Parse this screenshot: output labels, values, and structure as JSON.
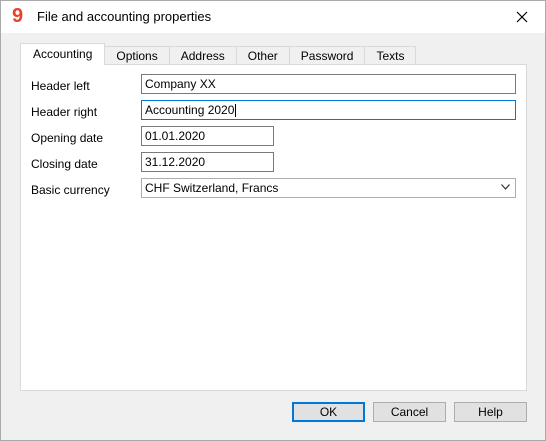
{
  "window": {
    "title": "File and accounting properties",
    "app_icon_glyph": "9",
    "close_icon": "close-icon",
    "accent_color": "#0078d7",
    "brand_color": "#e8412c"
  },
  "tabs": [
    {
      "label": "Accounting",
      "active": true
    },
    {
      "label": "Options",
      "active": false
    },
    {
      "label": "Address",
      "active": false
    },
    {
      "label": "Other",
      "active": false
    },
    {
      "label": "Password",
      "active": false
    },
    {
      "label": "Texts",
      "active": false
    }
  ],
  "form": {
    "header_left": {
      "label": "Header left",
      "value": "Company XX"
    },
    "header_right": {
      "label": "Header right",
      "value": "Accounting 2020"
    },
    "opening_date": {
      "label": "Opening date",
      "value": "01.01.2020"
    },
    "closing_date": {
      "label": "Closing date",
      "value": "31.12.2020"
    },
    "basic_currency": {
      "label": "Basic currency",
      "value": "CHF Switzerland, Francs"
    }
  },
  "buttons": {
    "ok": "OK",
    "cancel": "Cancel",
    "help": "Help"
  }
}
